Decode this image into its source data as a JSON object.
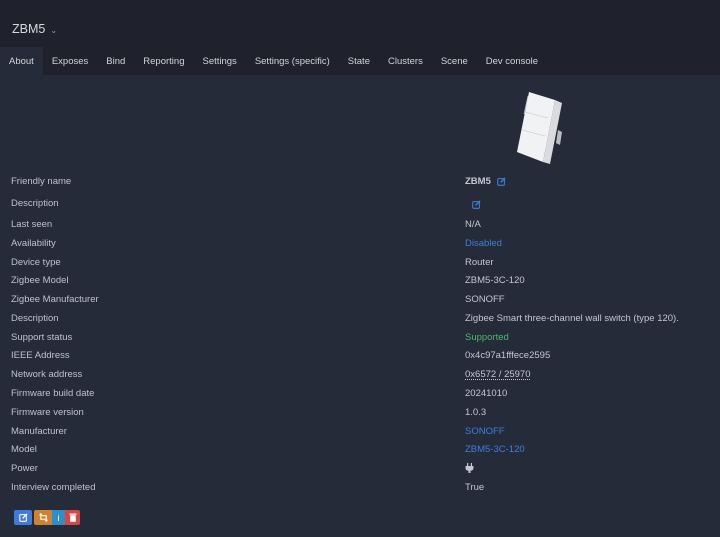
{
  "header": {
    "title": "ZBM5",
    "title_icon": "chevron-down-icon"
  },
  "tabs": [
    {
      "label": "About",
      "active": true
    },
    {
      "label": "Exposes"
    },
    {
      "label": "Bind"
    },
    {
      "label": "Reporting"
    },
    {
      "label": "Settings"
    },
    {
      "label": "Settings (specific)"
    },
    {
      "label": "State"
    },
    {
      "label": "Clusters"
    },
    {
      "label": "Scene"
    },
    {
      "label": "Dev console"
    }
  ],
  "device": {
    "image_alt": "ZBM5-3C-120 three-channel wall switch"
  },
  "rows": [
    {
      "label": "Friendly name",
      "value": "ZBM5",
      "edit": true
    },
    {
      "label": "Description",
      "value": "",
      "edit": true
    },
    {
      "label": "Last seen",
      "value": "N/A"
    },
    {
      "label": "Availability",
      "value": "Disabled",
      "style": "blue"
    },
    {
      "label": "Device type",
      "value": "Router"
    },
    {
      "label": "Zigbee Model",
      "value": "ZBM5-3C-120"
    },
    {
      "label": "Zigbee Manufacturer",
      "value": "SONOFF"
    },
    {
      "label": "Description",
      "value": "Zigbee Smart three-channel wall switch (type 120)."
    },
    {
      "label": "Support status",
      "value": "Supported",
      "style": "green"
    },
    {
      "label": "IEEE Address",
      "value": "0x4c97a1fffece2595"
    },
    {
      "label": "Network address",
      "value": "0x6572 / 25970",
      "style": "underline"
    },
    {
      "label": "Firmware build date",
      "value": "20241010"
    },
    {
      "label": "Firmware version",
      "value": "1.0.3"
    },
    {
      "label": "Manufacturer",
      "value": "SONOFF",
      "style": "blue"
    },
    {
      "label": "Model",
      "value": "ZBM5-3C-120",
      "style": "blue"
    },
    {
      "label": "Power",
      "value": "",
      "icon": "plug-icon"
    },
    {
      "label": "Interview completed",
      "value": "True"
    }
  ],
  "actions": [
    {
      "name": "edit",
      "icon": "edit-icon",
      "color": "#3d7be0"
    },
    {
      "name": "reconfigure",
      "icon": "exchange-icon",
      "color": "#d0832e"
    },
    {
      "name": "interview",
      "icon": "info-icon",
      "glyph": "i",
      "color": "#2e8fc8"
    },
    {
      "name": "remove",
      "icon": "trash-icon",
      "color": "#d64646"
    }
  ],
  "colors": {
    "header_bg": "#1f222c",
    "content_bg": "#262b3a",
    "link_blue": "#3d7fdc",
    "success_green": "#4bb86a"
  }
}
